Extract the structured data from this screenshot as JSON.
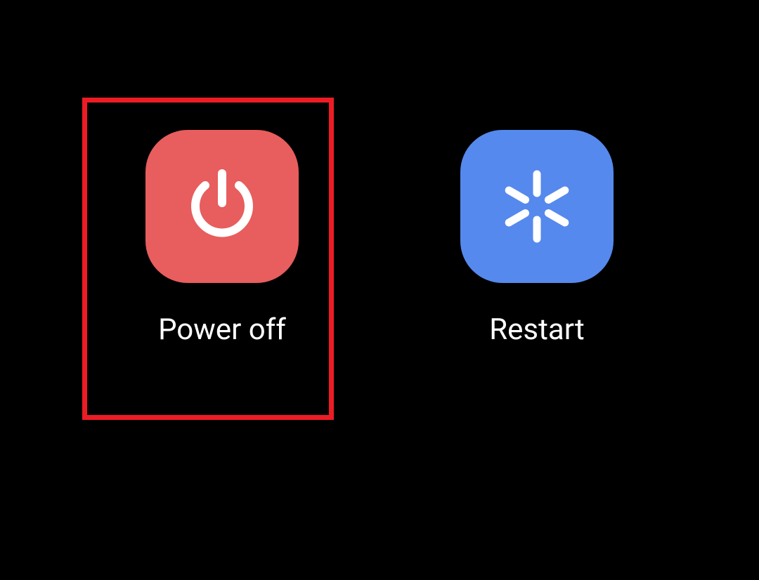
{
  "options": {
    "power_off": {
      "label": "Power off",
      "highlighted": true
    },
    "restart": {
      "label": "Restart",
      "highlighted": false
    }
  },
  "colors": {
    "power_off_bg": "#E85D5D",
    "restart_bg": "#5589ED",
    "highlight_border": "#ED1C24",
    "background": "#000000",
    "text": "#FFFFFF"
  }
}
